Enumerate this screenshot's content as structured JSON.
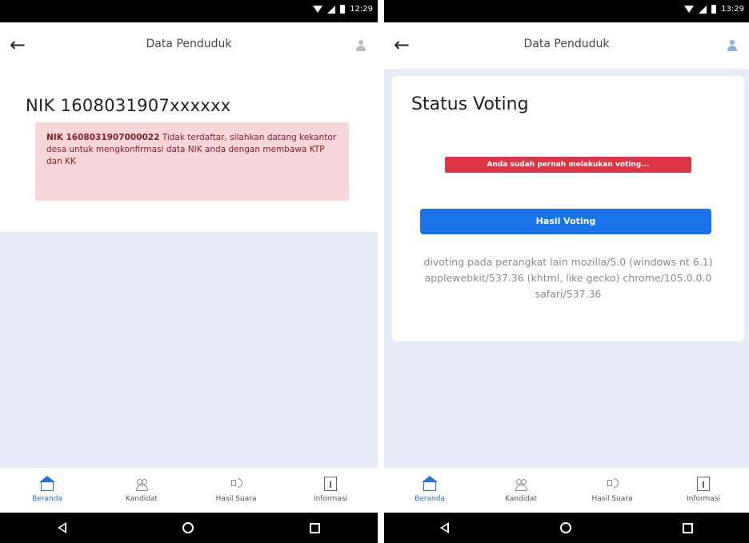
{
  "left_screen": {
    "status_time": "12:29",
    "appbar_title": "Data Penduduk",
    "nik_heading": "NIK 1608031907xxxxxx",
    "alert_bold": "NIK 1608031907000022",
    "alert_text": " Tidak terdaftar, silahkan datang kekantor desa untuk mengkonfirmasi data NIK anda dengan membawa KTP dan KK"
  },
  "right_screen": {
    "status_time": "13:29",
    "appbar_title": "Data Penduduk",
    "status_title": "Status Voting",
    "badge_text": "Anda sudah pernah melakukan voting...",
    "hasil_button": "Hasil Voting",
    "device_info": "divoting pada perangkat lain mozilla/5.0 (windows nt 6.1) applewebkit/537.36 (khtml, like gecko) chrome/105.0.0.0 safari/537.36"
  },
  "bottom_nav": [
    "Beranda",
    "Kandidat",
    "Hasil Suara",
    "Informasi"
  ],
  "colors": {
    "accent": "#1a73e8",
    "danger": "#dc3545",
    "alert_bg": "#f6d7d9",
    "page_bg": "#e8ebf8"
  },
  "icons": [
    "back-arrow-icon",
    "user-icon",
    "home-icon",
    "people-icon",
    "speaker-icon",
    "info-icon",
    "wifi-icon",
    "signal-icon",
    "battery-icon"
  ]
}
